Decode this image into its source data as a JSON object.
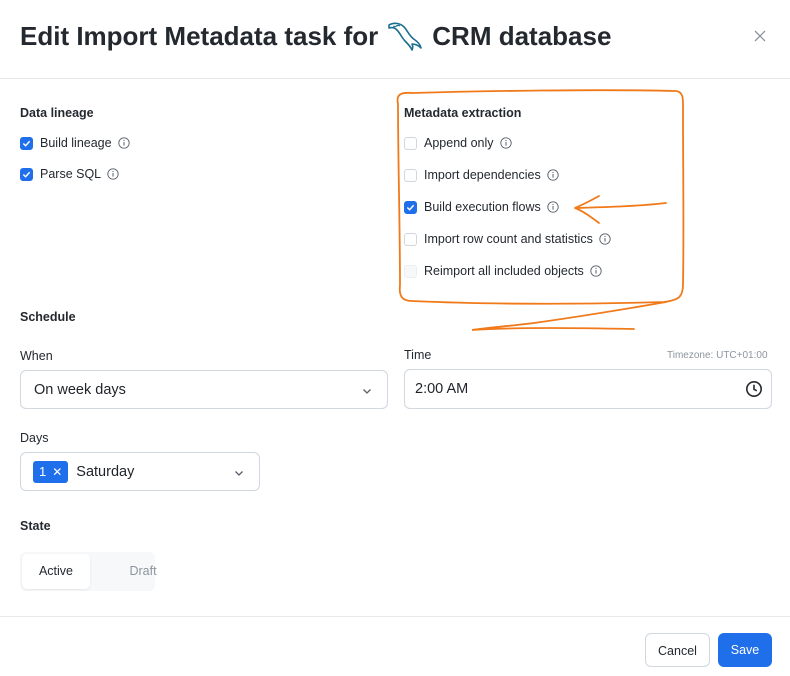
{
  "dialog": {
    "title_prefix": "Edit Import Metadata task for",
    "title_suffix": "CRM database",
    "db_icon": "mysql-dolphin-icon"
  },
  "data_lineage": {
    "heading": "Data lineage",
    "options": [
      {
        "label": "Build lineage",
        "checked": true
      },
      {
        "label": "Parse SQL",
        "checked": true
      }
    ]
  },
  "metadata_extraction": {
    "heading": "Metadata extraction",
    "options": [
      {
        "label": "Append only",
        "checked": false
      },
      {
        "label": "Import dependencies",
        "checked": false
      },
      {
        "label": "Build execution flows",
        "checked": true
      },
      {
        "label": "Import row count and statistics",
        "checked": false
      },
      {
        "label": "Reimport all included objects",
        "checked": false,
        "disabled": true
      }
    ]
  },
  "schedule": {
    "heading": "Schedule",
    "when_label": "When",
    "when_value": "On week days",
    "time_label": "Time",
    "time_value": "2:00 AM",
    "timezone": "Timezone: UTC+01:00",
    "days_label": "Days",
    "days_count": "1",
    "days_value": "Saturday"
  },
  "state": {
    "heading": "State",
    "options": [
      "Active",
      "Draft"
    ],
    "selected": "Active"
  },
  "footer": {
    "cancel_label": "Cancel",
    "save_label": "Save"
  },
  "colors": {
    "accent": "#1f6feb",
    "annotation": "#f07a1a"
  }
}
